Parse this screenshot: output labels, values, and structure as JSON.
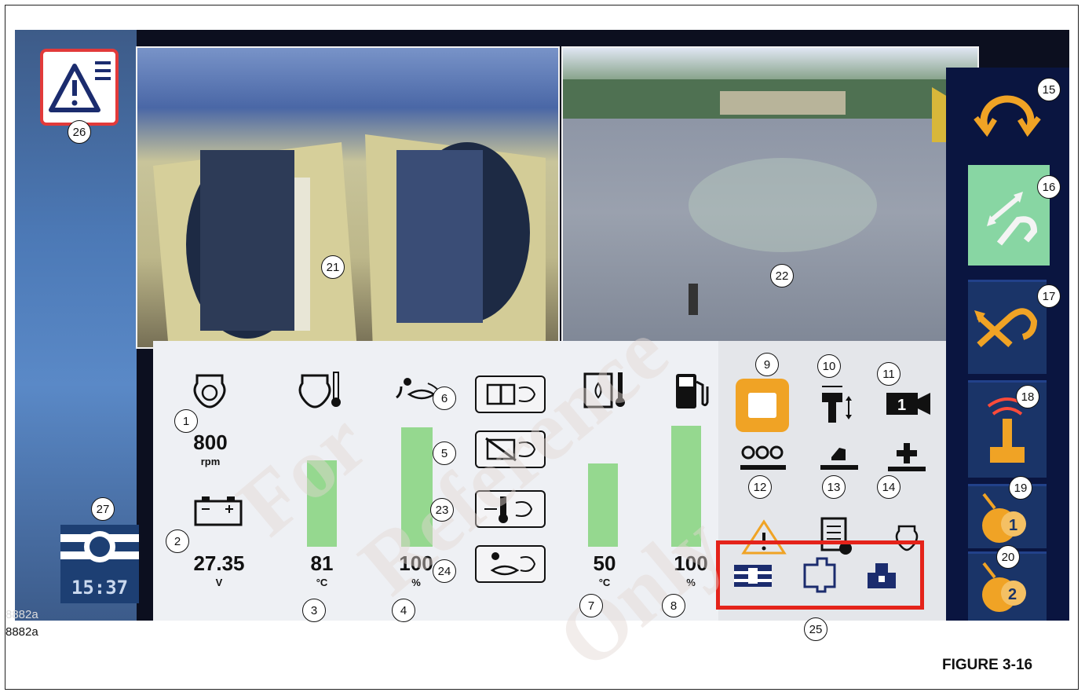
{
  "engine": {
    "speed_value": "800",
    "speed_unit": "rpm",
    "coolant_value": "81",
    "coolant_unit": "°C",
    "def_value": "100",
    "def_unit": "%",
    "hydraulic_temp_value": "50",
    "hydraulic_temp_unit": "°C",
    "fuel_value": "100",
    "fuel_unit": "%"
  },
  "battery": {
    "value": "27.35",
    "unit": "V"
  },
  "clock": {
    "time": "15:37"
  },
  "bars": {
    "coolant": 0.74,
    "def": 0.92,
    "hydraulic": 0.68,
    "fuel": 0.94
  },
  "callouts": [
    "1",
    "2",
    "3",
    "4",
    "5",
    "6",
    "7",
    "8",
    "9",
    "10",
    "11",
    "12",
    "13",
    "14",
    "15",
    "16",
    "17",
    "18",
    "19",
    "20",
    "21",
    "22",
    "23",
    "24",
    "25",
    "26",
    "27"
  ],
  "figure": {
    "label": "FIGURE 3-16",
    "image_id": "8882a"
  },
  "watermark": {
    "lines": [
      "For",
      "Reference",
      "Only"
    ]
  },
  "icons": [
    "warning-menu-icon",
    "engine-speed-icon",
    "engine-coolant-icon",
    "def-icon",
    "dpf-regen-icon",
    "dpf-inhibit-icon",
    "exhaust-temp-icon",
    "def-level-icon",
    "hydraulic-temp-icon",
    "fuel-icon",
    "square-stop-icon",
    "tool-height-icon",
    "camera-1-icon",
    "counters-icon",
    "hand-icon",
    "plus-icon",
    "warning-icon",
    "document-icon",
    "bulb-icon",
    "swing-icon",
    "boom-extend-icon",
    "jib-icon",
    "remote-control-icon",
    "winch-1-icon",
    "winch-2-icon",
    "display-tile-icon",
    "battery-icon"
  ],
  "colors": {
    "accent_yellow": "#f0a325",
    "sidebar_blue": "#0a1540",
    "highlight_red": "#e4231a",
    "bar_green": "#95d88f",
    "green_button": "#88d6a3"
  }
}
